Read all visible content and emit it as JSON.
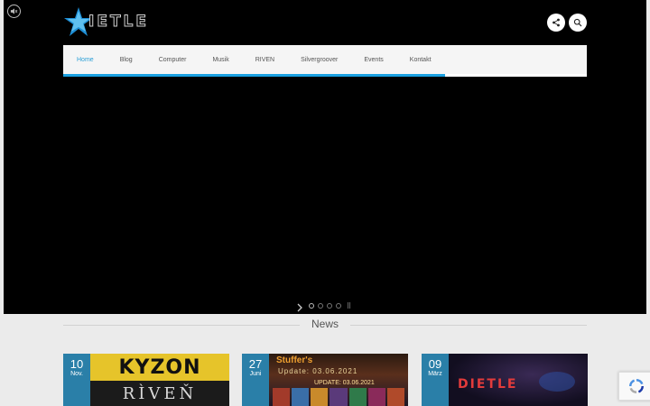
{
  "site": {
    "logo_text": "IETLE",
    "mute_icon": "speaker-muted-icon",
    "share_icon": "share-icon",
    "search_icon": "search-icon"
  },
  "nav": {
    "items": [
      {
        "label": "Home",
        "active": true
      },
      {
        "label": "Blog",
        "active": false
      },
      {
        "label": "Computer",
        "active": false
      },
      {
        "label": "Musik",
        "active": false
      },
      {
        "label": "RIVEN",
        "active": false
      },
      {
        "label": "Silvergroover",
        "active": false
      },
      {
        "label": "Events",
        "active": false
      },
      {
        "label": "Kontakt",
        "active": false
      }
    ],
    "accent_color": "#1ba1e2",
    "progress": 0.73
  },
  "slider": {
    "dot_count": 4,
    "active_dot": 0
  },
  "news": {
    "heading": "News",
    "cards": [
      {
        "day": "10",
        "month": "Nov.",
        "image_text_1": "KYZON",
        "image_text_2": "RÌVEŇ"
      },
      {
        "day": "27",
        "month": "Juni",
        "image_text_1": "Stuffer's",
        "image_text_2": "Update: 03.06.2021",
        "image_text_3": "UPDATE: 03.06.2021"
      },
      {
        "day": "09",
        "month": "März",
        "image_text_1": "DIETLE"
      }
    ]
  },
  "colors": {
    "hero_bg": "#000000",
    "page_bg": "#ebebeb",
    "date_badge": "#2a7fa8"
  }
}
